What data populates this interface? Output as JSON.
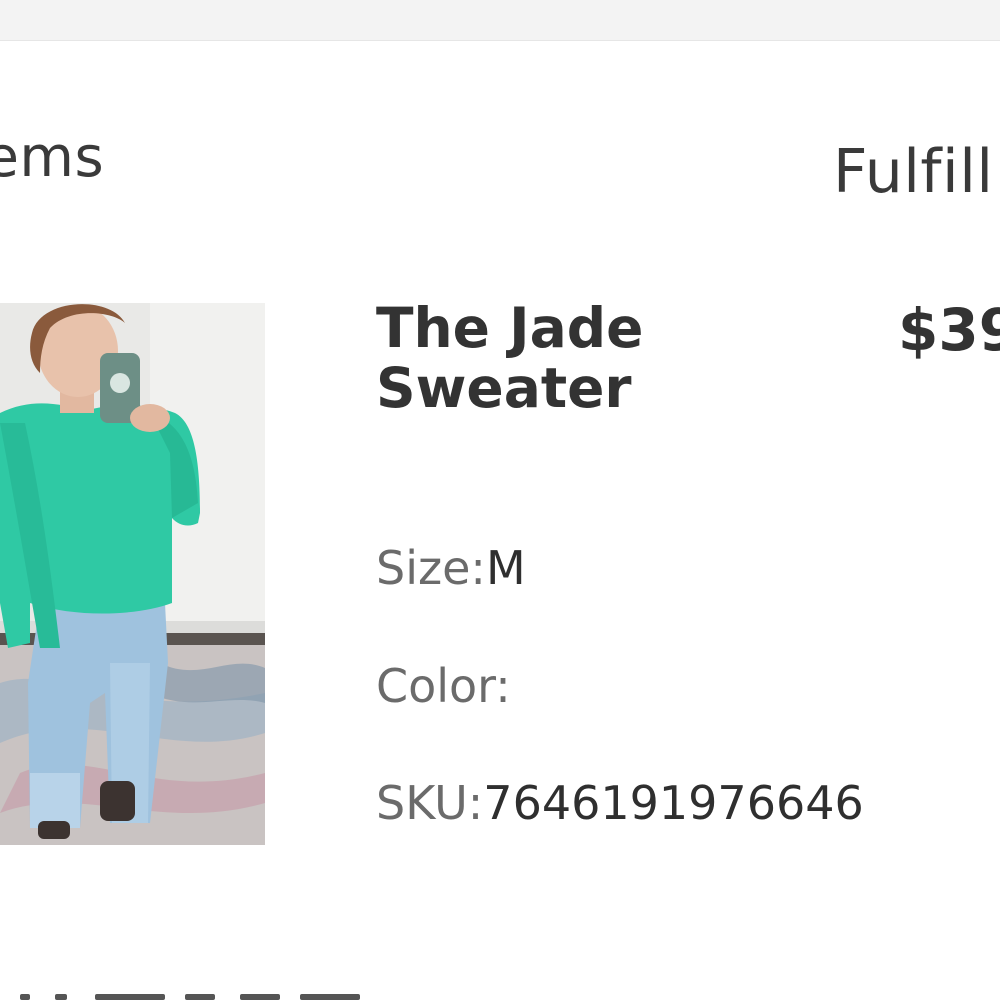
{
  "header": {
    "items_title": "tems",
    "fulfill_title": "Fulfill"
  },
  "product": {
    "image_alt": "woman in teal sweater and light wash wide leg jeans taking a mirror selfie",
    "name": "The Jade Sweater",
    "price": "$39",
    "size_label": "Size:",
    "size_value": "M",
    "color_label": "Color:",
    "color_value": "",
    "sku_label": "SKU:",
    "sku_value": "7646191976646"
  },
  "colors": {
    "text_dark": "#333333",
    "text_label": "#6b6b6b",
    "sweater": "#2fc9a4",
    "top_strip": "#f3f3f3"
  }
}
